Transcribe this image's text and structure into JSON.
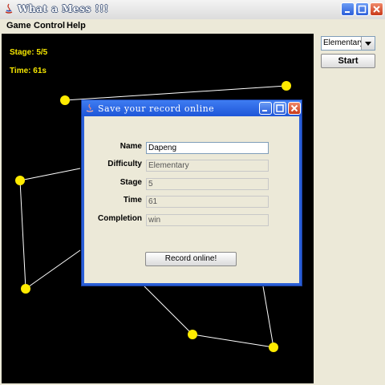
{
  "window": {
    "title": "What a Mess !!!"
  },
  "menu": [
    {
      "label": "Game"
    },
    {
      "label": "Control"
    },
    {
      "label": "Help"
    }
  ],
  "hud": {
    "stage": "Stage: 5/5",
    "time": "Time: 61s"
  },
  "controls": {
    "difficulty_selected": "Elementary",
    "start_label": "Start"
  },
  "dialog": {
    "title": "Save your record online",
    "fields": [
      {
        "label": "Name",
        "value": "Dapeng",
        "editable": true
      },
      {
        "label": "Difficulty",
        "value": "Elementary",
        "editable": false
      },
      {
        "label": "Stage",
        "value": "5",
        "editable": false
      },
      {
        "label": "Time",
        "value": "61",
        "editable": false
      },
      {
        "label": "Completion",
        "value": "win",
        "editable": false
      }
    ],
    "record_button": "Record online!"
  },
  "colors": {
    "node": "#ffeb00",
    "hud_text": "#f5e600",
    "canvas": "#000000",
    "edge": "#ffffff"
  }
}
